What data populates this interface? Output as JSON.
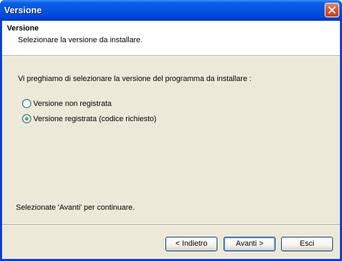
{
  "window": {
    "title": "Versione",
    "close_icon": "close-icon"
  },
  "header": {
    "title": "Versione",
    "subtitle": "Selezionare la versione da installare."
  },
  "main": {
    "instruction": "Vi preghiamo di selezionare la versione del programma da installare :",
    "options": [
      {
        "label": "Versione non registrata",
        "selected": false
      },
      {
        "label": "Versione registrata (codice richiesto)",
        "selected": true
      }
    ],
    "footer_note": "Selezionate 'Avanti' per continuare."
  },
  "buttons": {
    "back": "< Indietro",
    "next": "Avanti >",
    "cancel": "Esci"
  },
  "colors": {
    "titlebar": "#0555e0",
    "dialog_bg": "#ece9d8",
    "radio_dot": "#21a121",
    "close_button": "#d75733"
  }
}
